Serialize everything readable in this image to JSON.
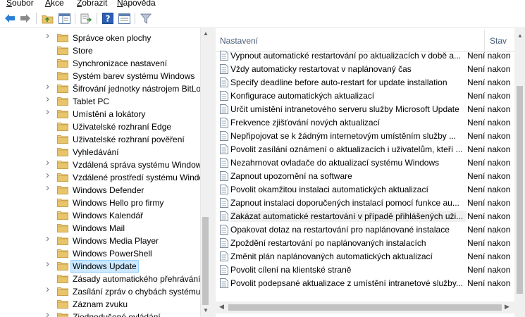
{
  "menu": {
    "items": [
      "Soubor",
      "Akce",
      "Zobrazit",
      "Nápověda"
    ]
  },
  "toolbar": {
    "icons": [
      "back-icon",
      "forward-icon",
      "up-folder-icon",
      "show-hide-tree-icon",
      "export-list-icon",
      "help-icon",
      "properties-icon",
      "filter-icon"
    ]
  },
  "tree": {
    "items": [
      {
        "label": "Správce oken plochy",
        "expandable": true
      },
      {
        "label": "Store",
        "expandable": false
      },
      {
        "label": "Synchronizace nastavení",
        "expandable": false
      },
      {
        "label": "Systém barev systému Windows",
        "expandable": false
      },
      {
        "label": "Šifrování jednotky nástrojem BitLo",
        "expandable": true
      },
      {
        "label": "Tablet PC",
        "expandable": true
      },
      {
        "label": "Umístění a lokátory",
        "expandable": true
      },
      {
        "label": "Uživatelské rozhraní Edge",
        "expandable": false
      },
      {
        "label": "Uživatelské rozhraní pověření",
        "expandable": false
      },
      {
        "label": "Vyhledávání",
        "expandable": false
      },
      {
        "label": "Vzdálená správa systému Window",
        "expandable": true
      },
      {
        "label": "Vzdálené prostředí systému Windo",
        "expandable": true
      },
      {
        "label": "Windows Defender",
        "expandable": true
      },
      {
        "label": "Windows Hello pro firmy",
        "expandable": false
      },
      {
        "label": "Windows Kalendář",
        "expandable": false
      },
      {
        "label": "Windows Mail",
        "expandable": false
      },
      {
        "label": "Windows Media Player",
        "expandable": true
      },
      {
        "label": "Windows PowerShell",
        "expandable": false
      },
      {
        "label": "Windows Update",
        "expandable": true,
        "selected": true
      },
      {
        "label": "Zásady automatického přehrávání",
        "expandable": false
      },
      {
        "label": "Zasílání zpráv o chybách systému",
        "expandable": true
      },
      {
        "label": "Záznam zvuku",
        "expandable": false
      },
      {
        "label": "Zjednodušené ovládání",
        "expandable": true
      }
    ]
  },
  "list": {
    "columns": {
      "name": "Nastavení",
      "state": "Stav"
    },
    "rows": [
      {
        "name": "Vypnout automatické restartování po aktualizacích v době a...",
        "state": "Není nakon"
      },
      {
        "name": "Vždy automaticky restartovat v naplánovaný čas",
        "state": "Není nakon"
      },
      {
        "name": "Specify deadline before auto-restart for update installation",
        "state": "Není nakon"
      },
      {
        "name": "Konfigurace automatických aktualizací",
        "state": "Není nakon"
      },
      {
        "name": "Určit umístění intranetového serveru služby Microsoft Update",
        "state": "Není nakon"
      },
      {
        "name": "Frekvence zjišťování nových aktualizací",
        "state": "Není nakon"
      },
      {
        "name": "Nepřipojovat se k žádným internetovým umístěním služby ...",
        "state": "Není nakon"
      },
      {
        "name": "Povolit zasílání oznámení o aktualizacích i uživatelům, kteří ...",
        "state": "Není nakon"
      },
      {
        "name": "Nezahrnovat ovladače do aktualizací systému Windows",
        "state": "Není nakon"
      },
      {
        "name": "Zapnout upozornění na software",
        "state": "Není nakon"
      },
      {
        "name": "Povolit okamžitou instalaci automatických aktualizací",
        "state": "Není nakon"
      },
      {
        "name": "Zapnout instalaci doporučených instalací pomocí funkce au...",
        "state": "Není nakon"
      },
      {
        "name": "Zakázat automatické restartování v případě přihlášených uži...",
        "state": "Není nakon",
        "highlight": true
      },
      {
        "name": "Opakovat dotaz na restartování pro naplánované instalace",
        "state": "Není nakon"
      },
      {
        "name": "Zpoždění restartování po naplánovaných instalacích",
        "state": "Není nakon"
      },
      {
        "name": "Změnit plán naplánovaných automatických aktualizací",
        "state": "Není nakon"
      },
      {
        "name": "Povolit cílení na klientské straně",
        "state": "Není nakon"
      },
      {
        "name": "Povolit podepsané aktualizace z umístění intranetové služby...",
        "state": "Není nakon"
      }
    ]
  },
  "colors": {
    "selection": "#cce8ff",
    "folder": "#e8c46a",
    "header_text": "#4c607a"
  }
}
